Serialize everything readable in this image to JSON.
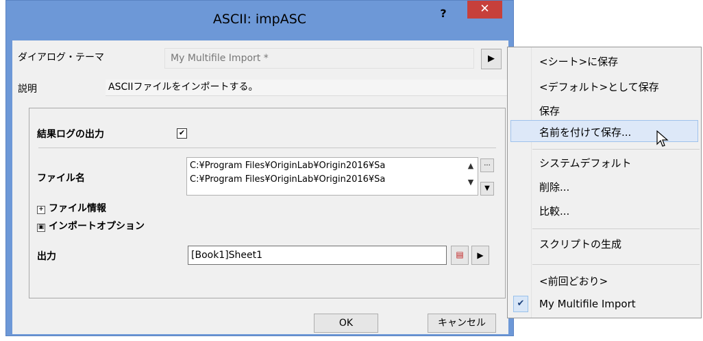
{
  "dialog": {
    "title": "ASCII: impASC",
    "help_label": "?",
    "close_label": "✕",
    "theme_label": "ダイアログ・テーマ",
    "theme_value": "My Multifile Import *",
    "description_label": "説明",
    "description_value": "ASCIIファイルをインポートする。",
    "result_log_label": "結果ログの出力",
    "result_log_checked": true,
    "file_name_label": "ファイル名",
    "files": [
      "C:¥Program Files¥OriginLab¥Origin2016¥Sa",
      "C:¥Program Files¥OriginLab¥Origin2016¥Sa"
    ],
    "browse_label": "...",
    "file_info_label": "ファイル情報",
    "import_options_label": "インポートオプション",
    "output_label": "出力",
    "output_value": "[Book1]Sheet1",
    "ok_label": "OK",
    "cancel_label": "キャンセル"
  },
  "menu": {
    "items": [
      {
        "label": "<シート>に保存"
      },
      {
        "label": "<デフォルト>として保存"
      },
      {
        "label": "保存"
      },
      {
        "label": "名前を付けて保存..."
      },
      {
        "label": "システムデフォルト"
      },
      {
        "label": "削除..."
      },
      {
        "label": "比較..."
      },
      {
        "label": "スクリプトの生成"
      },
      {
        "label": "<前回どおり>"
      },
      {
        "label": "My Multifile Import"
      }
    ],
    "highlighted_index": 3,
    "checked_index": 9
  },
  "colors": {
    "title_bar": "#6d98d7",
    "close_button": "#c7403b",
    "menu_highlight": "#dde8f8"
  }
}
